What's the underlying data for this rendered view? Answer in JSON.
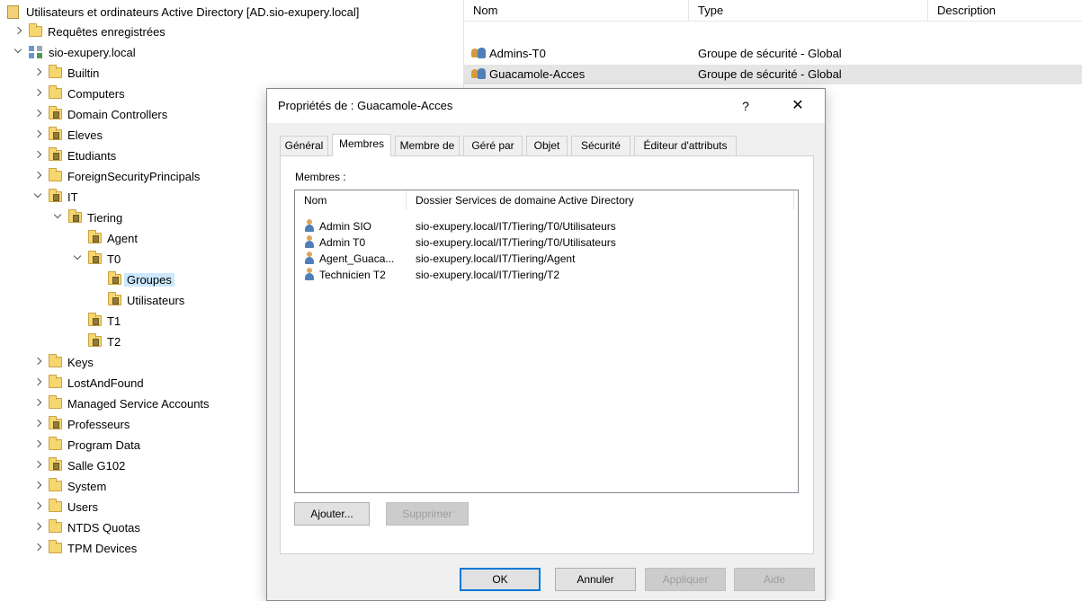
{
  "tree": {
    "root_label": "Utilisateurs et ordinateurs Active Directory [AD.sio-exupery.local]",
    "items": [
      {
        "label": "Requêtes enregistrées"
      },
      {
        "label": "sio-exupery.local"
      },
      {
        "label": "Builtin"
      },
      {
        "label": "Computers"
      },
      {
        "label": "Domain Controllers"
      },
      {
        "label": "Eleves"
      },
      {
        "label": "Etudiants"
      },
      {
        "label": "ForeignSecurityPrincipals"
      },
      {
        "label": "IT"
      },
      {
        "label": "Tiering"
      },
      {
        "label": "Agent"
      },
      {
        "label": "T0"
      },
      {
        "label": "Groupes"
      },
      {
        "label": "Utilisateurs"
      },
      {
        "label": "T1"
      },
      {
        "label": "T2"
      },
      {
        "label": "Keys"
      },
      {
        "label": "LostAndFound"
      },
      {
        "label": "Managed Service Accounts"
      },
      {
        "label": "Professeurs"
      },
      {
        "label": "Program Data"
      },
      {
        "label": "Salle G102"
      },
      {
        "label": "System"
      },
      {
        "label": "Users"
      },
      {
        "label": "NTDS Quotas"
      },
      {
        "label": "TPM Devices"
      }
    ]
  },
  "list": {
    "columns": [
      "Nom",
      "Type",
      "Description"
    ],
    "rows": [
      {
        "name": "Admins-T0",
        "type": "Groupe de sécurité - Global",
        "description": ""
      },
      {
        "name": "Guacamole-Acces",
        "type": "Groupe de sécurité - Global",
        "description": ""
      }
    ]
  },
  "dialog": {
    "title": "Propriétés de : Guacamole-Acces",
    "help": "?",
    "close": "✕",
    "tabs": [
      "Général",
      "Membres",
      "Membre de",
      "Géré par",
      "Objet",
      "Sécurité",
      "Éditeur d'attributs"
    ],
    "active_tab": "Membres",
    "members_label": "Membres :",
    "members_columns": [
      "Nom",
      "Dossier Services de domaine Active Directory"
    ],
    "members": [
      {
        "name": "Admin SIO",
        "folder": "sio-exupery.local/IT/Tiering/T0/Utilisateurs"
      },
      {
        "name": "Admin T0",
        "folder": "sio-exupery.local/IT/Tiering/T0/Utilisateurs"
      },
      {
        "name": "Agent_Guaca...",
        "folder": "sio-exupery.local/IT/Tiering/Agent"
      },
      {
        "name": "Technicien T2",
        "folder": "sio-exupery.local/IT/Tiering/T2"
      }
    ],
    "buttons": {
      "add": "Ajouter...",
      "remove": "Supprimer",
      "ok": "OK",
      "cancel": "Annuler",
      "apply": "Appliquer",
      "help": "Aide"
    }
  },
  "colors": {
    "selection": "#cce8ff",
    "default_button_border": "#0078d7",
    "dialog_background": "#f0f0f0"
  }
}
